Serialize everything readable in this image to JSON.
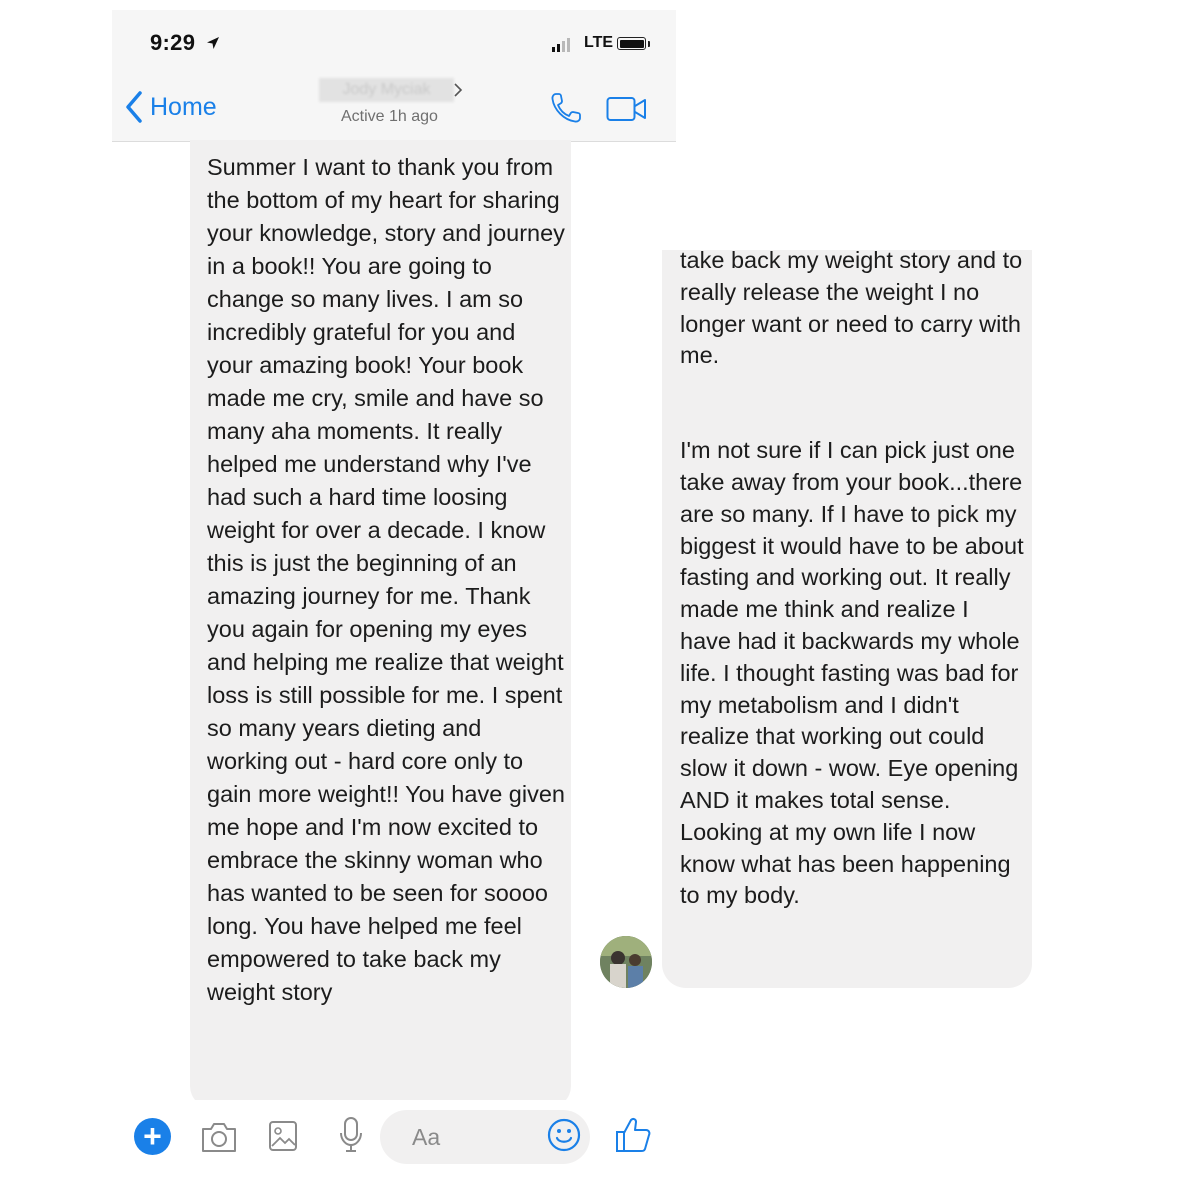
{
  "status_bar": {
    "time": "9:29",
    "carrier": "LTE"
  },
  "header": {
    "back_label": "Home",
    "contact_name": "Jody Myciak",
    "active_status": "Active 1h ago"
  },
  "icons": {
    "back": "chevron-left-icon",
    "phone": "phone-icon",
    "video": "video-camera-icon",
    "plus": "plus-icon",
    "camera": "camera-icon",
    "image": "image-icon",
    "mic": "microphone-icon",
    "emoji": "smiley-icon",
    "like": "thumbs-up-icon"
  },
  "colors": {
    "accent": "#1a80e8",
    "bubble": "#f1f0f0"
  },
  "conversation_left": {
    "message": "Summer I want to thank you from the bottom of my heart for sharing your knowledge, story and journey in a book!! You are going to change so many lives. I am so incredibly grateful for you and your amazing book! Your book made me cry, smile and have so many aha moments. It really helped me understand why I've had such a hard time loosing weight for over a decade. I know this is just the beginning of an amazing journey for me. Thank you again for opening my eyes and helping me realize that weight loss is still possible for me. I spent so many years dieting and working out - hard core only to gain more weight!! You have given me hope and I'm now excited to embrace the skinny woman who has wanted to be seen for soooo long. You have helped me feel empowered to take back my weight story"
  },
  "composer": {
    "placeholder": "Aa"
  },
  "conversation_right": {
    "message_part1": "take back my weight story and to really release the weight I no longer want or need to carry with me.",
    "message_part2": "I'm not sure if I can pick just one take away from your book...there are so many. If I have to pick my biggest it would have to be about fasting and working out. It really made me think and realize I have had it backwards my whole life. I thought fasting was bad for my metabolism and I didn't realize that working out could slow it down - wow. Eye opening AND it makes total sense. Looking at my own life I now know what has been happening to my body."
  }
}
